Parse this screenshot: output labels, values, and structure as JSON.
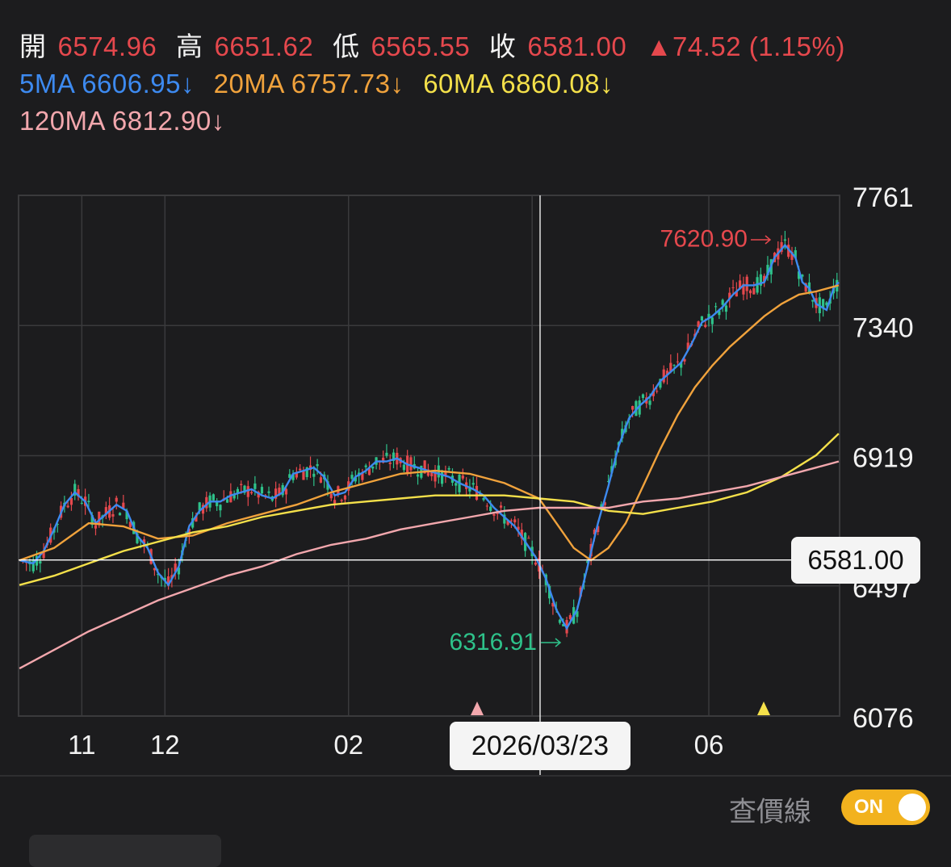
{
  "header": {
    "open_label": "開",
    "open_value": "6574.96",
    "high_label": "高",
    "high_value": "6651.62",
    "low_label": "低",
    "low_value": "6565.55",
    "close_label": "收",
    "close_value": "6581.00",
    "change": "▲74.52 (1.15%)",
    "ma5": "5MA 6606.95↓",
    "ma20": "20MA 6757.73↓",
    "ma60": "60MA 6860.08↓",
    "ma120": "120MA 6812.90↓"
  },
  "crosshair": {
    "price": "6581.00",
    "date": "2026/03/23"
  },
  "toggle": {
    "label": "查價線",
    "state": "ON"
  },
  "colors": {
    "up": "#e5484d",
    "down": "#2ec28a",
    "ma5": "#3d8af0",
    "ma20": "#f0a23c",
    "ma60": "#f4e04a",
    "ma120": "#f2a7ad",
    "grid": "#3a3a3c",
    "background": "#1c1c1e"
  },
  "chart_data": {
    "type": "candlestick",
    "ylim": [
      6076,
      7761
    ],
    "y_ticks": [
      "7761",
      "7340",
      "6919",
      "6497",
      "6076"
    ],
    "x_tick_labels": [
      "11",
      "12",
      "02",
      "06"
    ],
    "annotations": {
      "high": {
        "label": "7620.90",
        "value": 7620.9
      },
      "low": {
        "label": "6316.91",
        "value": 6316.91
      }
    },
    "crosshair_value": 6581.0,
    "markers": [
      "pink-triangle",
      "yellow-triangle"
    ],
    "grid": true,
    "ma_series": [
      {
        "name": "5MA",
        "points": [
          [
            0,
            6580
          ],
          [
            8,
            6570
          ],
          [
            14,
            6610
          ],
          [
            20,
            6680
          ],
          [
            26,
            6760
          ],
          [
            32,
            6800
          ],
          [
            38,
            6770
          ],
          [
            44,
            6700
          ],
          [
            50,
            6730
          ],
          [
            56,
            6760
          ],
          [
            62,
            6740
          ],
          [
            68,
            6660
          ],
          [
            74,
            6620
          ],
          [
            80,
            6540
          ],
          [
            86,
            6500
          ],
          [
            92,
            6560
          ],
          [
            98,
            6690
          ],
          [
            104,
            6740
          ],
          [
            110,
            6770
          ],
          [
            116,
            6770
          ],
          [
            122,
            6790
          ],
          [
            128,
            6800
          ],
          [
            134,
            6810
          ],
          [
            140,
            6790
          ],
          [
            146,
            6780
          ],
          [
            152,
            6800
          ],
          [
            158,
            6860
          ],
          [
            164,
            6870
          ],
          [
            170,
            6880
          ],
          [
            176,
            6850
          ],
          [
            182,
            6790
          ],
          [
            188,
            6800
          ],
          [
            194,
            6850
          ],
          [
            200,
            6870
          ],
          [
            206,
            6900
          ],
          [
            212,
            6900
          ],
          [
            218,
            6910
          ],
          [
            224,
            6890
          ],
          [
            230,
            6880
          ],
          [
            236,
            6870
          ],
          [
            242,
            6860
          ],
          [
            248,
            6850
          ],
          [
            254,
            6830
          ],
          [
            258,
            6820
          ],
          [
            262,
            6810
          ],
          [
            268,
            6790
          ],
          [
            274,
            6750
          ],
          [
            280,
            6720
          ],
          [
            286,
            6690
          ],
          [
            292,
            6640
          ],
          [
            298,
            6590
          ],
          [
            304,
            6520
          ],
          [
            310,
            6420
          ],
          [
            316,
            6360
          ],
          [
            322,
            6420
          ],
          [
            328,
            6560
          ],
          [
            334,
            6700
          ],
          [
            340,
            6820
          ],
          [
            346,
            6950
          ],
          [
            352,
            7040
          ],
          [
            358,
            7080
          ],
          [
            364,
            7110
          ],
          [
            370,
            7160
          ],
          [
            376,
            7190
          ],
          [
            382,
            7220
          ],
          [
            388,
            7280
          ],
          [
            394,
            7350
          ],
          [
            400,
            7370
          ],
          [
            406,
            7400
          ],
          [
            412,
            7440
          ],
          [
            418,
            7470
          ],
          [
            424,
            7470
          ],
          [
            430,
            7480
          ],
          [
            436,
            7560
          ],
          [
            442,
            7600
          ],
          [
            448,
            7560
          ],
          [
            452,
            7480
          ],
          [
            456,
            7460
          ],
          [
            460,
            7410
          ],
          [
            466,
            7390
          ],
          [
            470,
            7460
          ],
          [
            473,
            7480
          ]
        ]
      },
      {
        "name": "20MA",
        "points": [
          [
            0,
            6580
          ],
          [
            20,
            6620
          ],
          [
            40,
            6700
          ],
          [
            60,
            6690
          ],
          [
            80,
            6650
          ],
          [
            100,
            6660
          ],
          [
            120,
            6700
          ],
          [
            140,
            6730
          ],
          [
            160,
            6760
          ],
          [
            180,
            6800
          ],
          [
            200,
            6830
          ],
          [
            220,
            6860
          ],
          [
            240,
            6870
          ],
          [
            260,
            6860
          ],
          [
            280,
            6830
          ],
          [
            300,
            6780
          ],
          [
            310,
            6700
          ],
          [
            320,
            6620
          ],
          [
            330,
            6580
          ],
          [
            340,
            6620
          ],
          [
            350,
            6700
          ],
          [
            360,
            6820
          ],
          [
            370,
            6940
          ],
          [
            380,
            7050
          ],
          [
            390,
            7140
          ],
          [
            400,
            7210
          ],
          [
            410,
            7270
          ],
          [
            420,
            7320
          ],
          [
            430,
            7370
          ],
          [
            440,
            7410
          ],
          [
            450,
            7440
          ],
          [
            460,
            7450
          ],
          [
            473,
            7470
          ]
        ]
      },
      {
        "name": "60MA",
        "points": [
          [
            0,
            6500
          ],
          [
            20,
            6530
          ],
          [
            40,
            6570
          ],
          [
            60,
            6610
          ],
          [
            80,
            6640
          ],
          [
            100,
            6670
          ],
          [
            120,
            6690
          ],
          [
            140,
            6720
          ],
          [
            160,
            6740
          ],
          [
            180,
            6760
          ],
          [
            200,
            6770
          ],
          [
            220,
            6780
          ],
          [
            240,
            6790
          ],
          [
            260,
            6790
          ],
          [
            280,
            6790
          ],
          [
            300,
            6780
          ],
          [
            320,
            6770
          ],
          [
            340,
            6740
          ],
          [
            360,
            6730
          ],
          [
            380,
            6750
          ],
          [
            400,
            6770
          ],
          [
            420,
            6800
          ],
          [
            440,
            6850
          ],
          [
            460,
            6920
          ],
          [
            473,
            6990
          ]
        ]
      },
      {
        "name": "120MA",
        "points": [
          [
            0,
            6230
          ],
          [
            20,
            6290
          ],
          [
            40,
            6350
          ],
          [
            60,
            6400
          ],
          [
            80,
            6450
          ],
          [
            100,
            6490
          ],
          [
            120,
            6530
          ],
          [
            140,
            6560
          ],
          [
            160,
            6600
          ],
          [
            180,
            6630
          ],
          [
            200,
            6650
          ],
          [
            220,
            6680
          ],
          [
            240,
            6700
          ],
          [
            260,
            6720
          ],
          [
            280,
            6740
          ],
          [
            300,
            6750
          ],
          [
            320,
            6750
          ],
          [
            340,
            6750
          ],
          [
            360,
            6770
          ],
          [
            380,
            6780
          ],
          [
            400,
            6800
          ],
          [
            420,
            6820
          ],
          [
            440,
            6850
          ],
          [
            460,
            6880
          ],
          [
            473,
            6900
          ]
        ]
      }
    ]
  }
}
